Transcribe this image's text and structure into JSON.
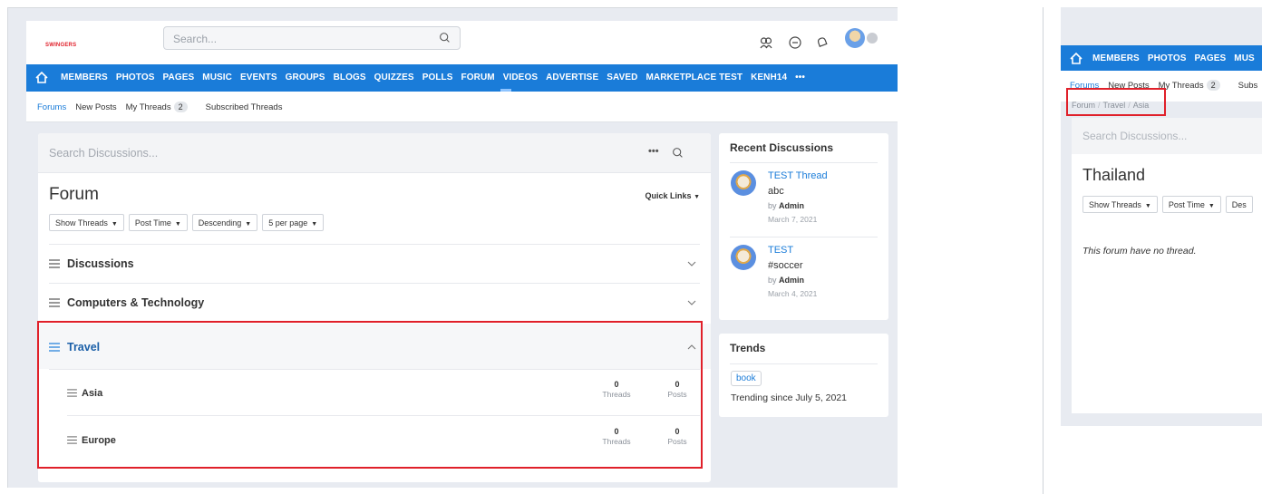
{
  "left": {
    "logo": "SWINGERS",
    "search_placeholder": "Search...",
    "nav": {
      "items": [
        "MEMBERS",
        "PHOTOS",
        "PAGES",
        "MUSIC",
        "EVENTS",
        "GROUPS",
        "BLOGS",
        "QUIZZES",
        "POLLS",
        "FORUM",
        "VIDEOS",
        "ADVERTISE",
        "SAVED",
        "MARKETPLACE TEST",
        "KENH14",
        "•••"
      ],
      "active": "FORUM"
    },
    "subnav": {
      "forums": "Forums",
      "new_posts": "New Posts",
      "my_threads": "My Threads",
      "my_threads_count": "2",
      "subscribed": "Subscribed Threads"
    },
    "main": {
      "search_placeholder": "Search Discussions...",
      "title": "Forum",
      "quick_links": "Quick Links",
      "filters": [
        "Show Threads",
        "Post Time",
        "Descending",
        "5 per page"
      ],
      "categories": [
        {
          "name": "Discussions"
        },
        {
          "name": "Computers & Technology"
        },
        {
          "name": "Travel"
        }
      ],
      "subforums": [
        {
          "name": "Asia",
          "threads": "0",
          "posts": "0"
        },
        {
          "name": "Europe",
          "threads": "0",
          "posts": "0"
        }
      ],
      "threads_label": "Threads",
      "posts_label": "Posts"
    },
    "recent": {
      "title": "Recent Discussions",
      "items": [
        {
          "title": "TEST Thread",
          "text": "abc",
          "by": "by",
          "author": "Admin",
          "date": "March 7, 2021"
        },
        {
          "title": "TEST",
          "text": "#soccer",
          "by": "by",
          "author": "Admin",
          "date": "March 4, 2021"
        }
      ]
    },
    "trends": {
      "title": "Trends",
      "tag": "book",
      "since": "Trending since July 5, 2021"
    }
  },
  "right": {
    "nav": [
      "MEMBERS",
      "PHOTOS",
      "PAGES",
      "MUS"
    ],
    "subnav": {
      "forums": "Forums",
      "new_posts": "New Posts",
      "my_threads": "My Threads",
      "count": "2",
      "subs": "Subs"
    },
    "breadcrumb": [
      "Forum",
      "Travel",
      "Asia"
    ],
    "search_placeholder": "Search Discussions...",
    "title": "Thailand",
    "filters": [
      "Show Threads",
      "Post Time",
      "Des"
    ],
    "empty": "This forum have no thread."
  },
  "colors": {
    "brand": "#1a7cd9",
    "highlight": "#e0202a",
    "bg": "#e8ebf1"
  }
}
